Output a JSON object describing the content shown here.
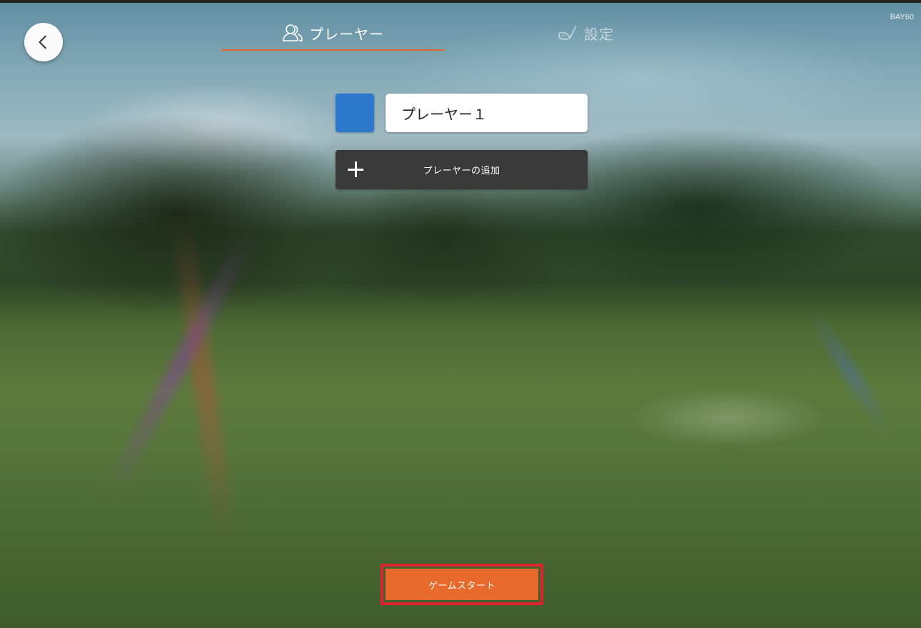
{
  "header": {
    "bay_label": "BAY60",
    "tabs": [
      {
        "label": "プレーヤー",
        "icon": "players-icon",
        "active": true
      },
      {
        "label": "設定",
        "icon": "golf-club-icon",
        "active": false
      }
    ]
  },
  "players": [
    {
      "name": "プレーヤー１",
      "color": "#2b78cc"
    }
  ],
  "add_player": {
    "label": "プレーヤーの追加",
    "icon": "plus-icon"
  },
  "start_button": {
    "label": "ゲームスタート"
  },
  "colors": {
    "accent": "#e76a2c",
    "tab_underline": "#e06a2e",
    "highlight": "#e0222a",
    "add_button_bg": "#3a3a3a"
  }
}
